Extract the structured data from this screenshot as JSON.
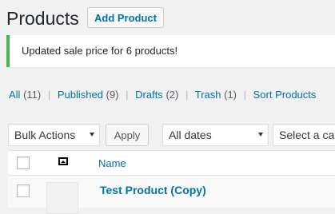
{
  "header": {
    "title": "Products",
    "add_button_label": "Add Product"
  },
  "notice": {
    "message": "Updated sale price for 6 products!",
    "accent_color": "#46b450"
  },
  "filters": [
    {
      "label": "All",
      "count": "(11)"
    },
    {
      "label": "Published",
      "count": "(9)"
    },
    {
      "label": "Drafts",
      "count": "(2)"
    },
    {
      "label": "Trash",
      "count": "(1)"
    },
    {
      "label": "Sort Products",
      "count": ""
    }
  ],
  "tablenav": {
    "bulk_actions_selected": "Bulk Actions",
    "apply_label": "Apply",
    "dates_selected": "All dates",
    "category_placeholder": "Select a cat"
  },
  "table": {
    "columns": {
      "image_icon": "image-icon",
      "name_label": "Name"
    },
    "rows": [
      {
        "name": "Test Product (Copy)"
      }
    ]
  },
  "colors": {
    "link": "#0073aa",
    "background": "#f1f1f1"
  }
}
